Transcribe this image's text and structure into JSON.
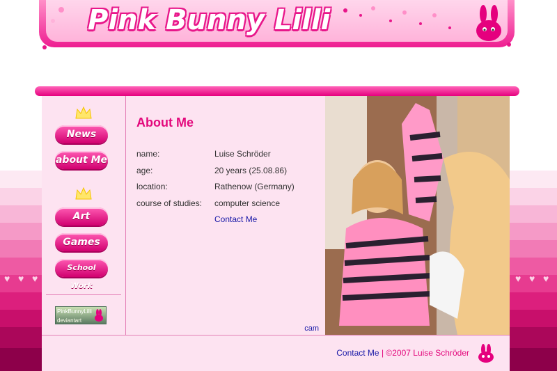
{
  "site": {
    "logo_text": "Pink Bunny Lilli"
  },
  "nav": {
    "items": [
      {
        "label": "News"
      },
      {
        "label": "about Me"
      },
      {
        "label": "Art"
      },
      {
        "label": "Games"
      },
      {
        "label": "School Work"
      }
    ],
    "deviantart_badge": {
      "title": "PinkBunnyLilli",
      "subtitle": "deviantart"
    }
  },
  "about": {
    "heading": "About Me",
    "rows": [
      {
        "label": "name:",
        "value": "Luise Schröder"
      },
      {
        "label": "age:",
        "value": "20 years (25.08.86)"
      },
      {
        "label": "location:",
        "value": "Rathenow (Germany)"
      },
      {
        "label": "course of studies:",
        "value": "computer science"
      }
    ],
    "contact_link": "Contact Me",
    "cam_link": "cam"
  },
  "footer": {
    "contact": "Contact Me",
    "separator": "|",
    "copyright": "©2007 Luise Schröder"
  },
  "colors": {
    "accent": "#e3087c",
    "link": "#1a1aa8",
    "panel": "#fde3f1"
  },
  "icons": [
    "crown-icon",
    "bunny-icon",
    "deviantart-icon"
  ]
}
